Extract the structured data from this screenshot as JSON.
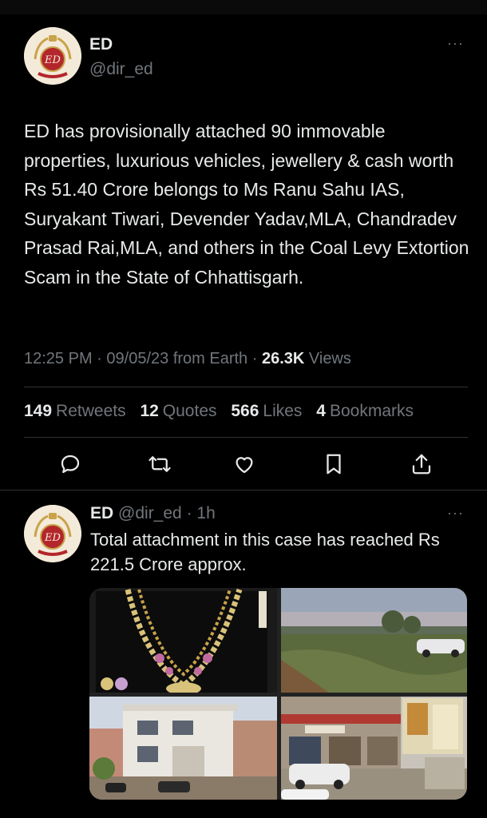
{
  "main_tweet": {
    "author_name": "ED",
    "author_handle": "@dir_ed",
    "more_glyph": "···",
    "text": "ED has provisionally attached 90 immovable properties, luxurious vehicles, jewellery & cash worth Rs 51.40 Crore belongs to Ms Ranu Sahu IAS, Suryakant Tiwari, Devender Yadav,MLA, Chandradev Prasad Rai,MLA, and others in the Coal Levy Extortion Scam in the State of Chhattisgarh.",
    "time": "12:25 PM",
    "date": "09/05/23",
    "source": "from Earth",
    "views_count": "26.3K",
    "views_label": "Views",
    "stats": {
      "retweets_count": "149",
      "retweets_label": "Retweets",
      "quotes_count": "12",
      "quotes_label": "Quotes",
      "likes_count": "566",
      "likes_label": "Likes",
      "bookmarks_count": "4",
      "bookmarks_label": "Bookmarks"
    },
    "actions": [
      "reply-icon",
      "retweet-icon",
      "like-icon",
      "bookmark-icon",
      "share-icon"
    ]
  },
  "reply_tweet": {
    "author_name": "ED",
    "author_handle": "@dir_ed",
    "age": "1h",
    "more_glyph": "···",
    "text": "Total attachment in this case has reached Rs 221.5 Crore approx.",
    "media": [
      "jewellery-photo",
      "land-plot-photo",
      "house-photo",
      "shops-photo"
    ]
  },
  "colors": {
    "background": "#000000",
    "text": "#e7e9ea",
    "secondary": "#71767b",
    "divider": "#2f3336",
    "logo_red": "#b3262b",
    "logo_gold": "#c9a34a"
  }
}
